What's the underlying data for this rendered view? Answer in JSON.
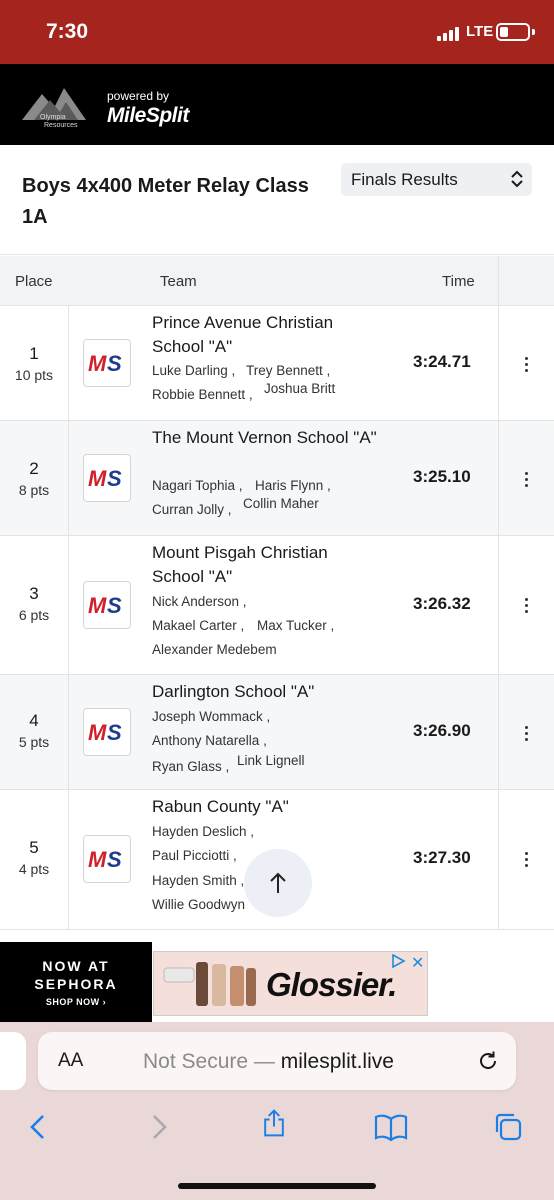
{
  "status": {
    "time": "7:30",
    "network": "LTE",
    "battery_level": 0.3
  },
  "brand": {
    "logo_text_1": "Olympia",
    "logo_text_2": "Resources",
    "powered_by": "powered by",
    "milesplit": "MileSplit"
  },
  "event": {
    "title": "Boys 4x400 Meter Relay Class 1A",
    "round": "Finals Results"
  },
  "table": {
    "headers": {
      "place": "Place",
      "team": "Team",
      "time": "Time"
    },
    "rows": [
      {
        "place": "1",
        "points": "10 pts",
        "team": "Prince Avenue Christian School \"A\"",
        "athletes": [
          "Luke Darling ,",
          "Trey Bennett ,",
          "Robbie Bennett ,",
          "Joshua Britt"
        ],
        "time": "3:24.71"
      },
      {
        "place": "2",
        "points": "8 pts",
        "team": "The Mount Vernon School \"A\"",
        "athletes": [
          "Nagari Tophia ,",
          "Haris Flynn ,",
          "Curran Jolly ,",
          "Collin Maher"
        ],
        "time": "3:25.10"
      },
      {
        "place": "3",
        "points": "6 pts",
        "team": "Mount Pisgah Christian School \"A\"",
        "athletes": [
          "Nick Anderson ,",
          "Makael Carter ,",
          "Max Tucker ,",
          "Alexander Medebem"
        ],
        "time": "3:26.32"
      },
      {
        "place": "4",
        "points": "5 pts",
        "team": "Darlington School \"A\"",
        "athletes": [
          "Joseph Wommack ,",
          "Anthony Natarella ,",
          "Ryan Glass ,",
          "Link Lignell"
        ],
        "time": "3:26.90"
      },
      {
        "place": "5",
        "points": "4 pts",
        "team": "Rabun County \"A\"",
        "athletes": [
          "Hayden Deslich ,",
          "Paul Picciotti ,",
          "Hayden Smith ,",
          "Willie Goodwyn"
        ],
        "time": "3:27.30"
      }
    ]
  },
  "ad": {
    "line1": "NOW AT",
    "line2": "SEPHORA",
    "line3": "SHOP NOW ›",
    "brand": "Glossier."
  },
  "browser": {
    "aa_label": "AA",
    "security": "Not Secure —",
    "domain": "milesplit.live"
  },
  "colors": {
    "status_bar": "#a5241e",
    "ms_red": "#d0202b",
    "ms_blue": "#1d3c8f"
  }
}
